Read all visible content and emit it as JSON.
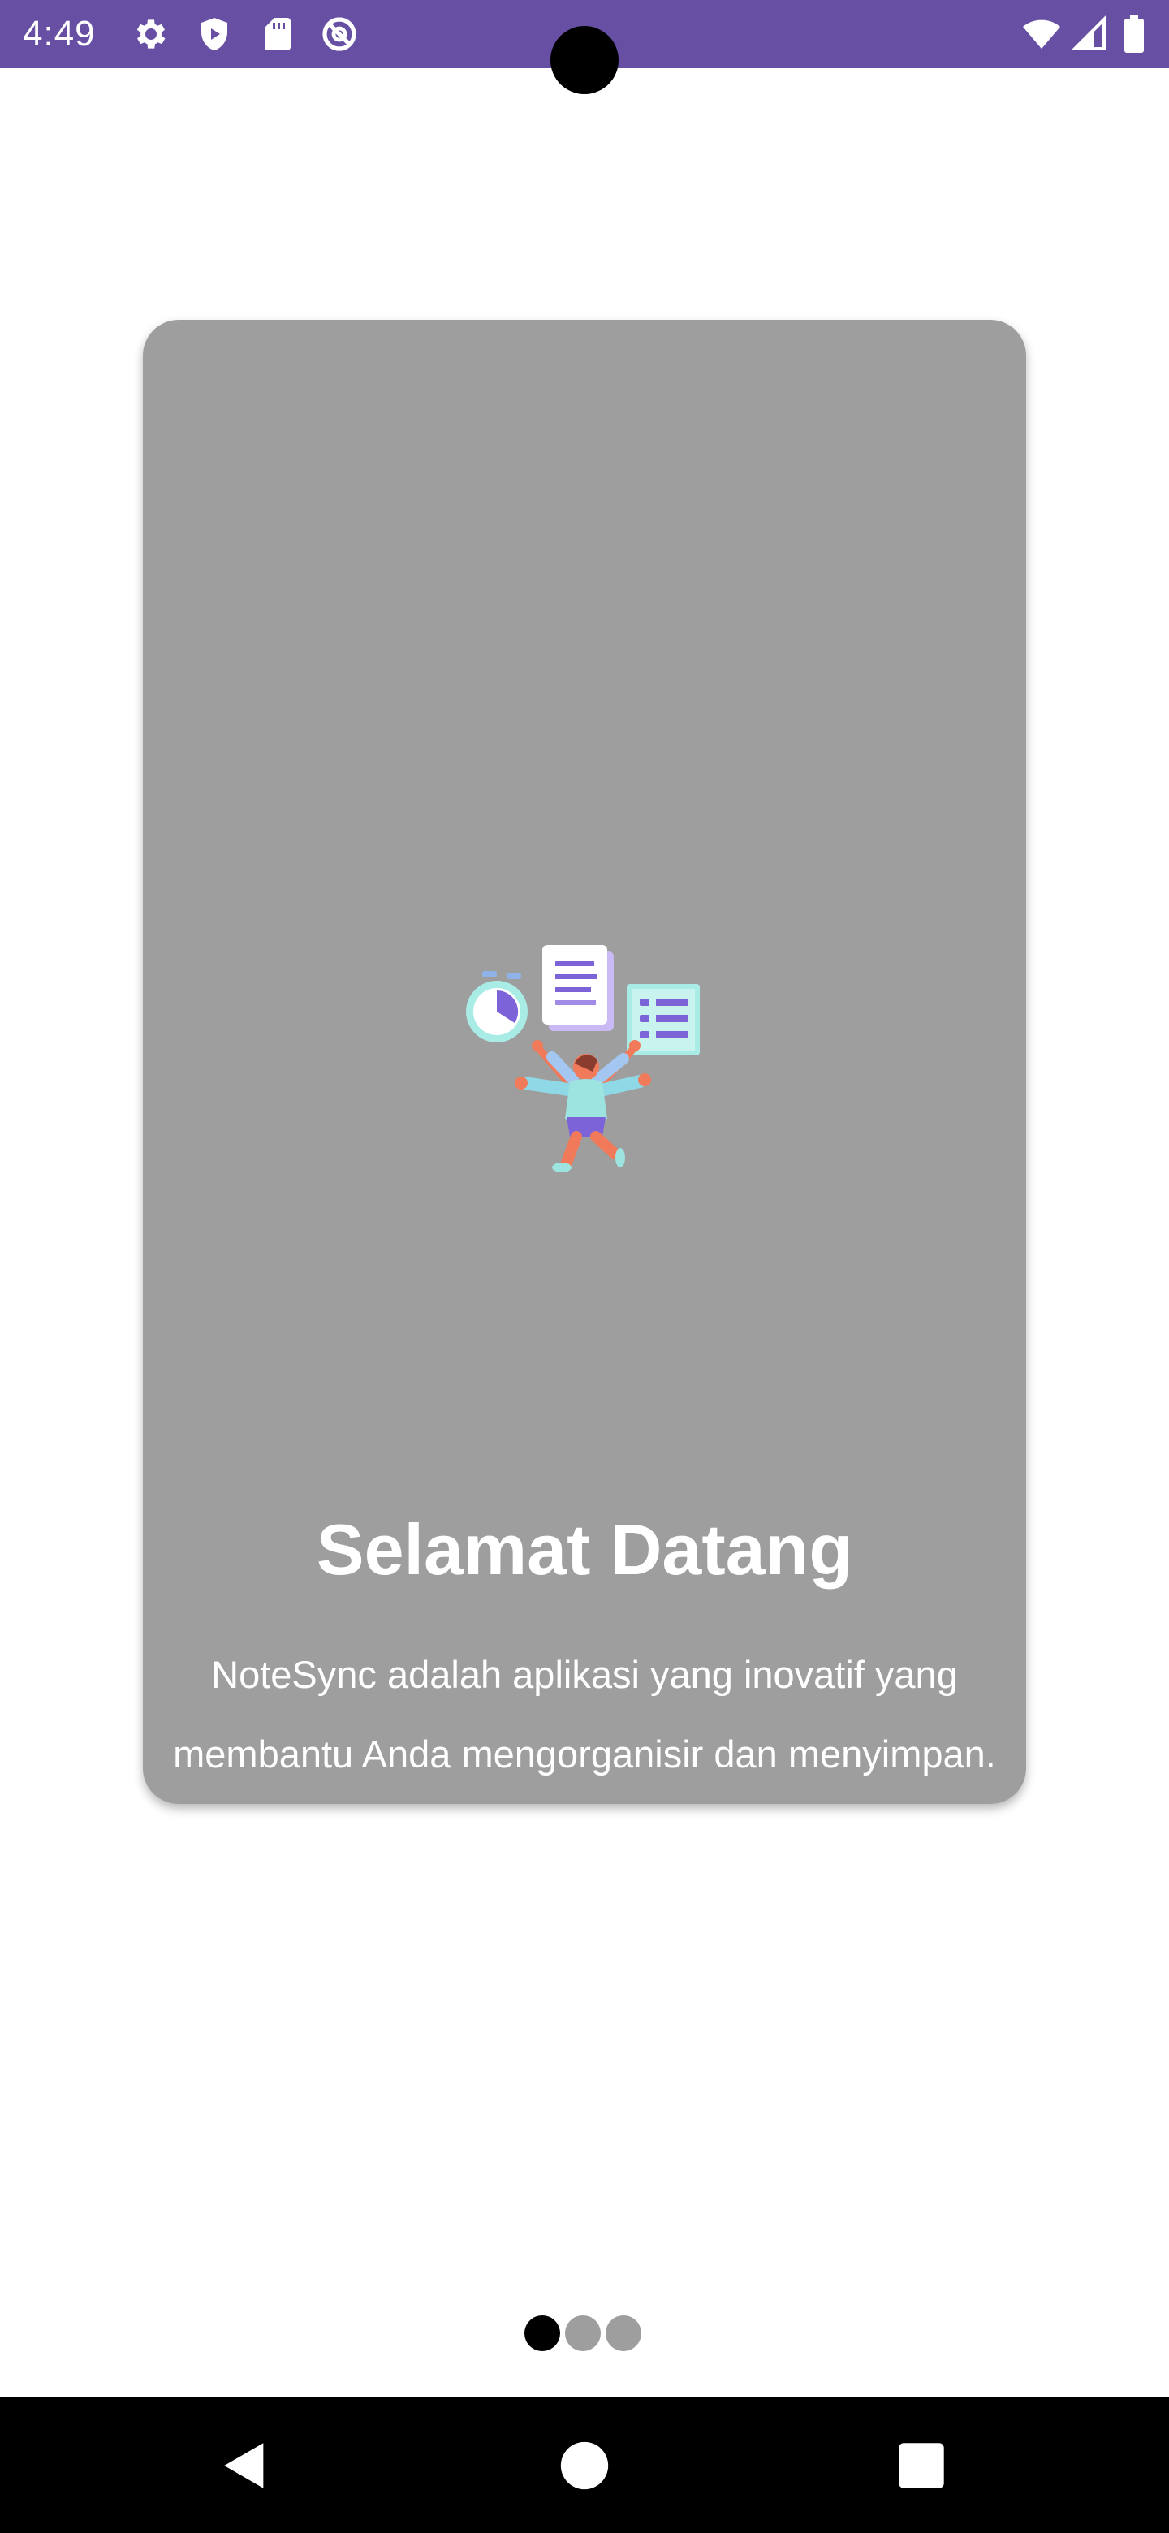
{
  "status_bar": {
    "time": "4:49",
    "background": "#6750a4",
    "left_icons": [
      "settings-gear-icon",
      "shield-play-icon",
      "sd-card-icon",
      "at-sign-icon"
    ],
    "right_icons": [
      "wifi-icon",
      "cell-signal-icon",
      "battery-icon"
    ]
  },
  "onboarding": {
    "card_color": "#9e9e9e",
    "illustration": "person-juggling-notes-illustration",
    "title": "Selamat Datang",
    "description_line1": "NoteSync adalah aplikasi yang inovatif yang",
    "description_line2": "membantu Anda mengorganisir dan menyimpan."
  },
  "page_indicator": {
    "total": 3,
    "current": 1,
    "active_color": "#000000",
    "inactive_color": "#9e9e9e"
  },
  "navigation_bar": {
    "buttons": [
      "back-icon",
      "home-icon",
      "recents-icon"
    ]
  }
}
